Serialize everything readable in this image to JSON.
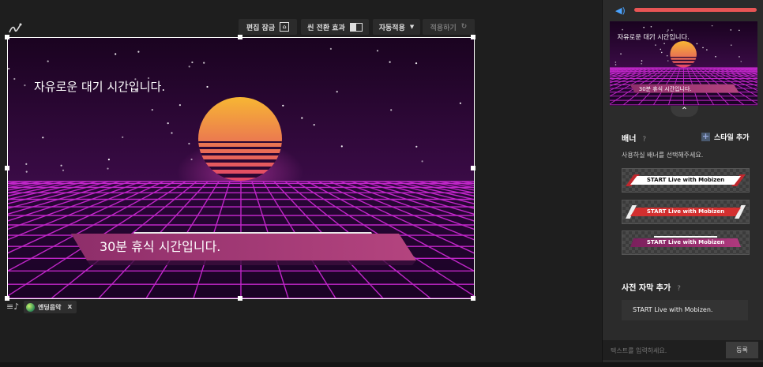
{
  "toolbar": {
    "edit_lock": "편집 잠금",
    "edit_lock_icon": "lock-icon",
    "scene_transition": "씬 전환 효과",
    "auto_apply": "자동적용",
    "apply": "적용하기",
    "apply_icon": "refresh-icon"
  },
  "preview": {
    "waiting_text": "자유로운 대기 시간입니다.",
    "banner_text": "30분 휴식 시간입니다."
  },
  "music": {
    "name": "엔딩음악",
    "close": "x"
  },
  "sidebar": {
    "volume_percent": 100,
    "thumbnail": {
      "waiting_text": "자유로운 대기 시간입니다.",
      "banner_text": "30분 휴식 시간입니다."
    },
    "banner_section": {
      "title": "배너",
      "help": "?",
      "add_style": "스타일 추가",
      "hint": "사용하실 배너를 선택해주세요.",
      "options": [
        {
          "label": "START Live with Mobizen"
        },
        {
          "label": "START Live with Mobizen"
        },
        {
          "label": "START Live with Mobizen"
        }
      ]
    },
    "subtitle_section": {
      "title": "사전 자막 추가",
      "help": "?",
      "preset": "START Live with Mobizen."
    },
    "input": {
      "placeholder": "텍스트를 입력하세요.",
      "submit": "등록"
    }
  },
  "colors": {
    "accent_volume": "#e85555",
    "volume_icon": "#4aa3ff",
    "sky": "#1c0423",
    "grid": "#c026c8",
    "sun_top": "#f7b733",
    "sun_bottom": "#e0406a",
    "banner_band": "#a03672"
  }
}
